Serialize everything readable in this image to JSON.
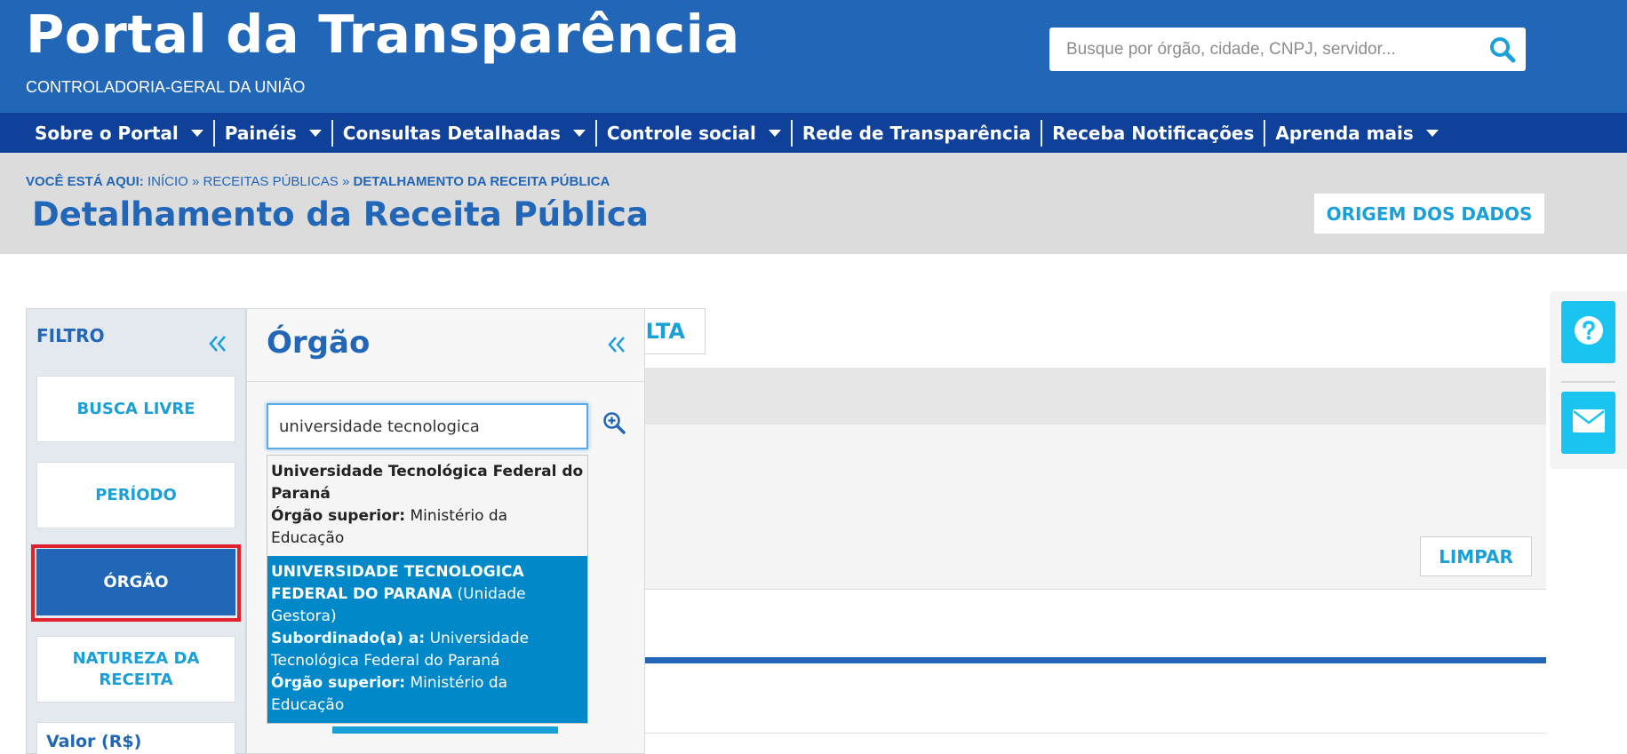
{
  "header": {
    "site_title": "Portal da Transparência",
    "site_subtitle": "CONTROLADORIA-GERAL DA UNIÃO",
    "search_placeholder": "Busque por órgão, cidade, CNPJ, servidor...",
    "search_icon": "search-icon"
  },
  "nav": {
    "items": [
      {
        "label": "Sobre o Portal",
        "has_dropdown": true
      },
      {
        "label": "Painéis",
        "has_dropdown": true
      },
      {
        "label": "Consultas Detalhadas",
        "has_dropdown": true
      },
      {
        "label": "Controle social",
        "has_dropdown": true
      },
      {
        "label": "Rede de Transparência",
        "has_dropdown": false
      },
      {
        "label": "Receba Notificações",
        "has_dropdown": false
      },
      {
        "label": "Aprenda mais",
        "has_dropdown": true
      }
    ]
  },
  "breadcrumb": {
    "prefix": "VOCÊ ESTÁ AQUI:",
    "items": [
      "INÍCIO",
      "RECEITAS PÚBLICAS"
    ],
    "separator": "»",
    "current": "DETALHAMENTO DA RECEITA PÚBLICA"
  },
  "page": {
    "title": "Detalhamento da Receita Pública",
    "origem_button": "ORIGEM DOS DADOS"
  },
  "floating": {
    "help_icon": "question-icon",
    "mail_icon": "envelope-icon"
  },
  "filter": {
    "title": "FILTRO",
    "buttons": [
      {
        "label": "BUSCA LIVRE",
        "active": false
      },
      {
        "label": "PERÍODO",
        "active": false
      },
      {
        "label": "ÓRGÃO",
        "active": true
      },
      {
        "label": "NATUREZA DA RECEITA",
        "active": false
      }
    ],
    "valor_label": "Valor (R$)"
  },
  "orgao": {
    "title": "Órgão",
    "input_value": "universidade tecnologica",
    "results": [
      {
        "name": "Universidade Tecnológica Federal do Paraná",
        "superior_label": "Órgão superior:",
        "superior_value": "Ministério da Educação"
      },
      {
        "name": "UNIVERSIDADE TECNOLOGICA FEDERAL DO PARANA",
        "type": "(Unidade Gestora)",
        "subordinado_label": "Subordinado(a) a:",
        "subordinado_value": "Universidade Tecnológica Federal do Paraná",
        "superior_label": "Órgão superior:",
        "superior_value": "Ministério da Educação"
      }
    ]
  },
  "main": {
    "consulta_button_partial": "LTA",
    "limpar_button": "LIMPAR"
  },
  "colors": {
    "primary": "#2266b7",
    "nav": "#10419a",
    "accent": "#1aa0d8",
    "highlight": "#0088c9",
    "float_button": "#19c4f0",
    "active_outline": "#e1212b"
  }
}
